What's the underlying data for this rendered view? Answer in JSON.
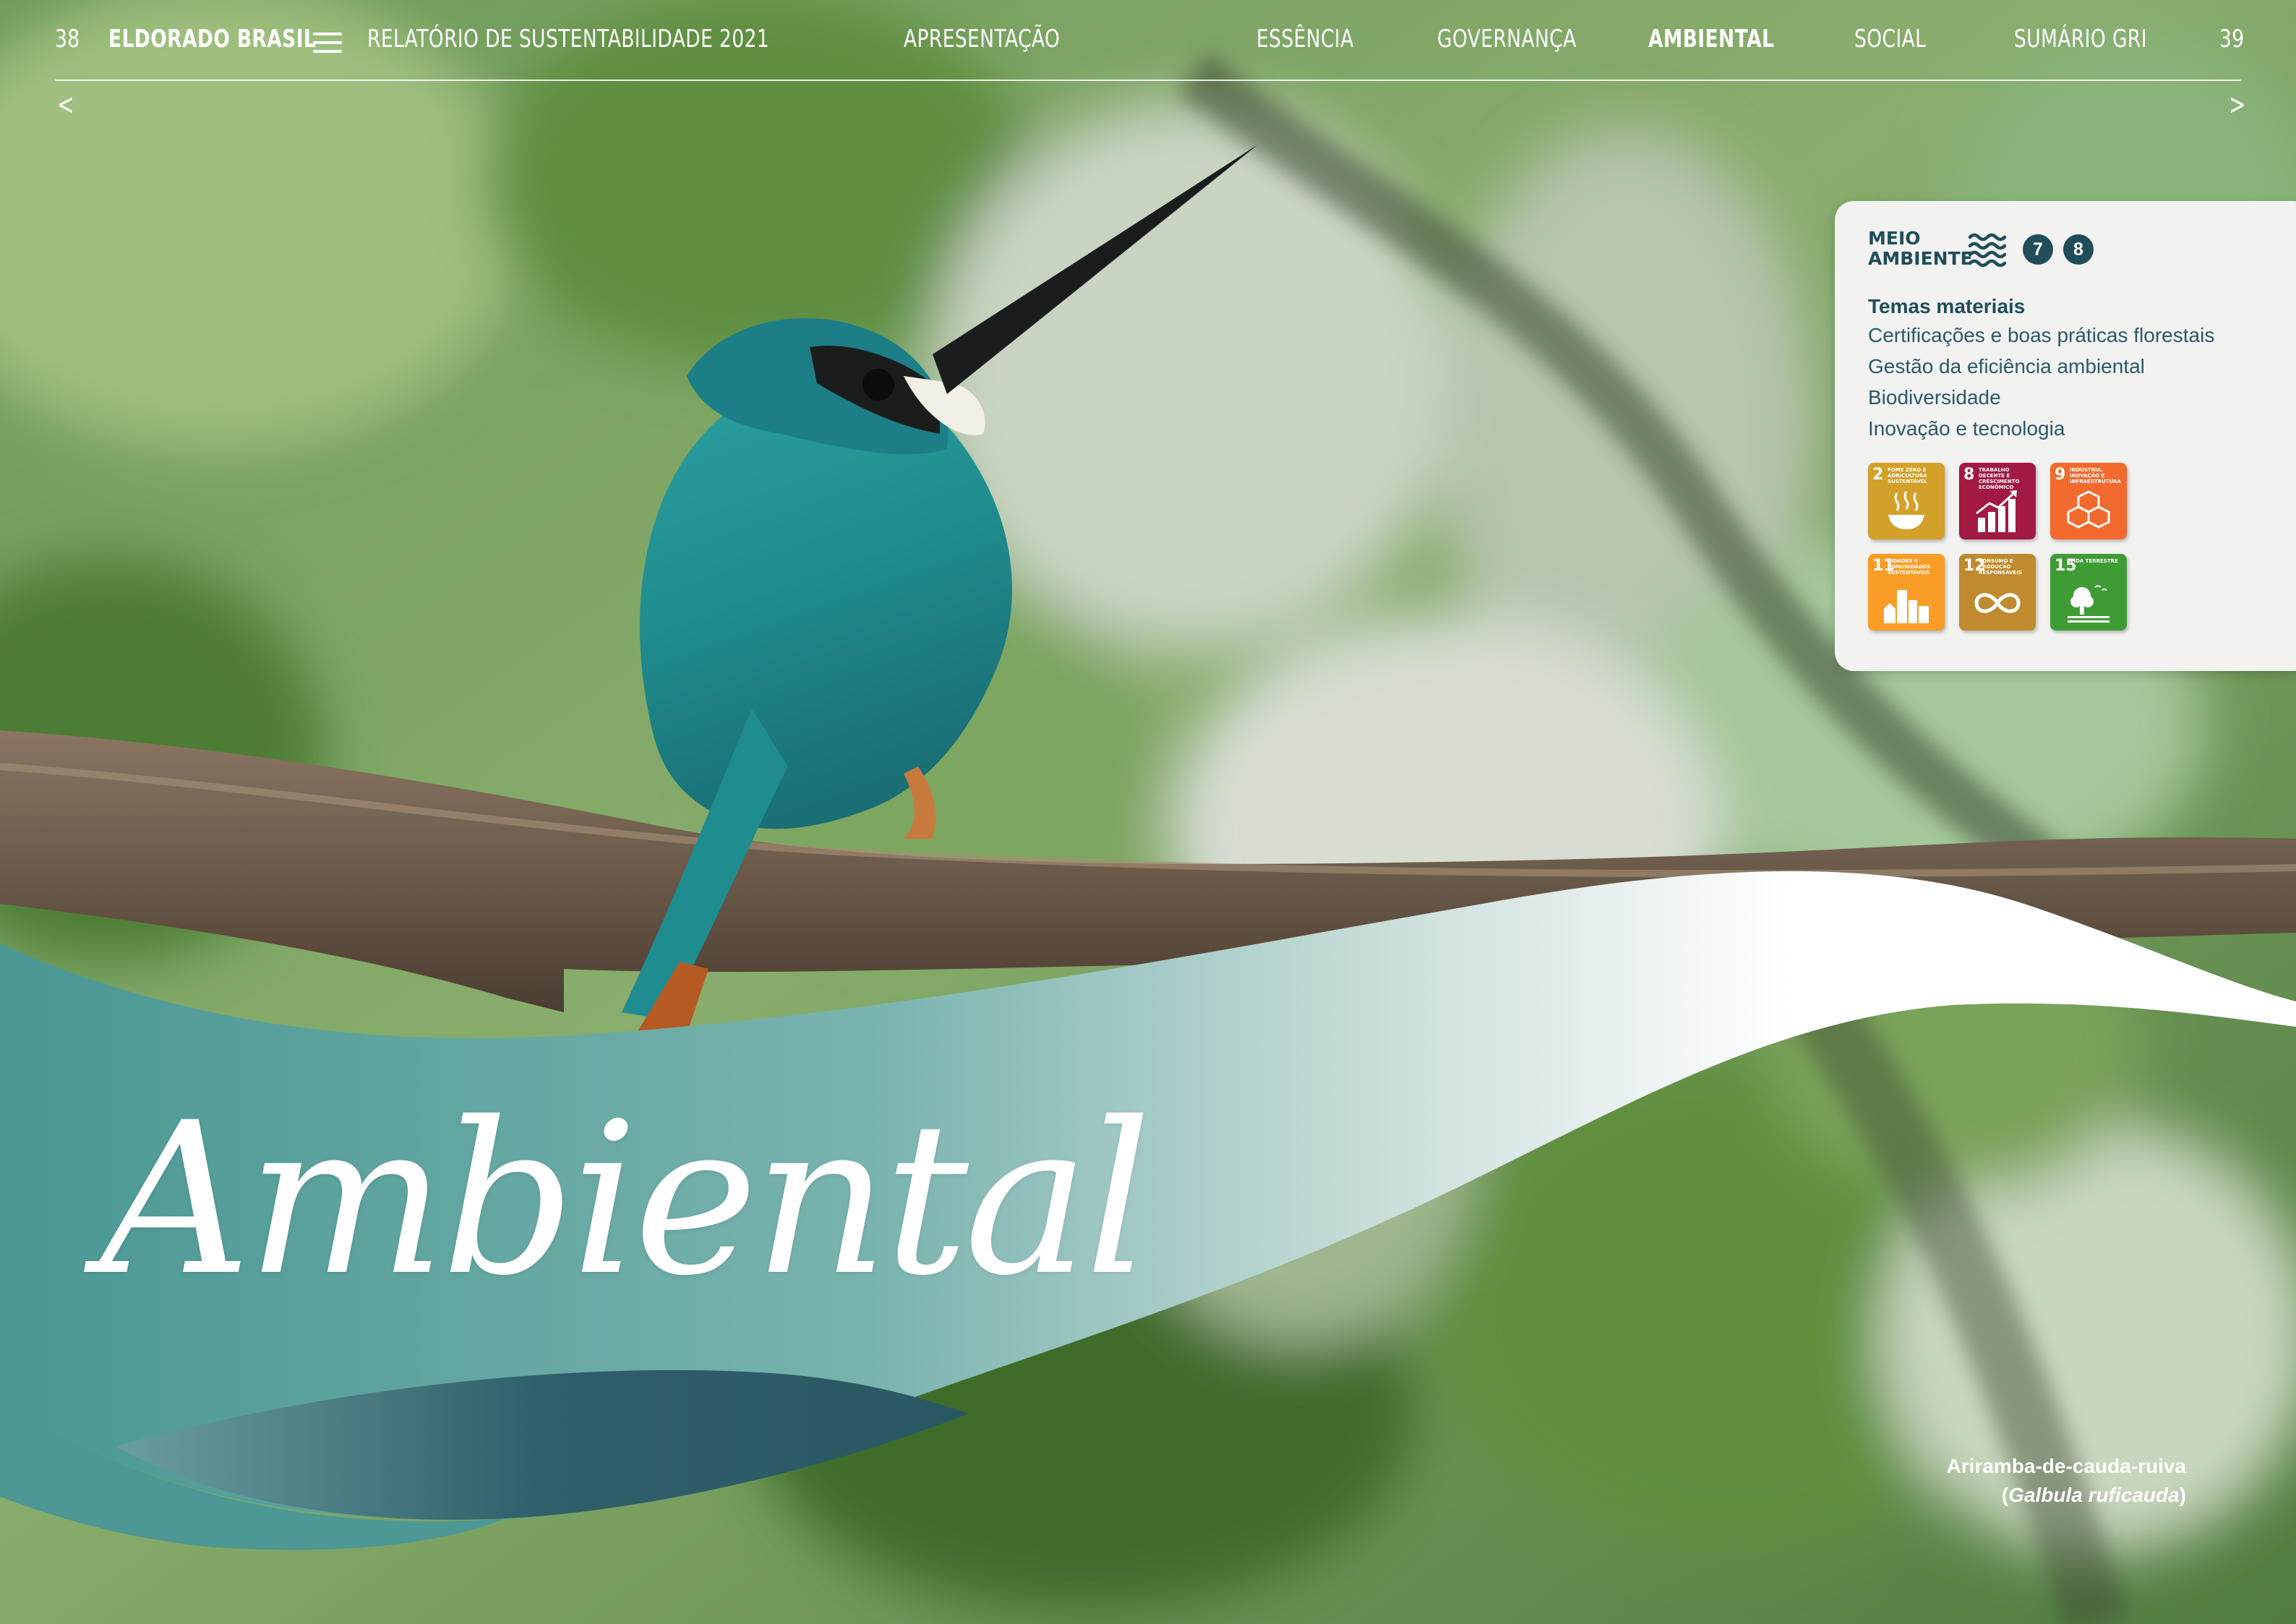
{
  "nav": {
    "page_left": "38",
    "brand": "ELDORADO BRASIL",
    "report": "RELATÓRIO DE SUSTENTABILIDADE 2021",
    "items": [
      {
        "label": "APRESENTAÇÃO",
        "active": false
      },
      {
        "label": "ESSÊNCIA",
        "active": false
      },
      {
        "label": "GOVERNANÇA",
        "active": false
      },
      {
        "label": "AMBIENTAL",
        "active": true
      },
      {
        "label": "SOCIAL",
        "active": false
      },
      {
        "label": "SUMÁRIO GRI",
        "active": false
      }
    ],
    "page_right": "39",
    "prev": "<",
    "next": ">"
  },
  "card": {
    "title_line1": "MEIO",
    "title_line2": "AMBIENTE",
    "badges": [
      "7",
      "8"
    ],
    "topics_title": "Temas materiais",
    "topics": [
      "Certificações e boas práticas florestais",
      "Gestão da eficiência ambiental",
      "Biodiversidade",
      "Inovação e tecnologia"
    ],
    "sdgs": [
      {
        "num": "2",
        "label": "FOME ZERO E AGRICULTURA SUSTENTÁVEL",
        "color": "#d3a029",
        "icon": "bowl-icon"
      },
      {
        "num": "8",
        "label": "TRABALHO DECENTE E CRESCIMENTO ECONÔMICO",
        "color": "#a21942",
        "icon": "growth-chart-icon"
      },
      {
        "num": "9",
        "label": "INDÚSTRIA, INOVAÇÃO E INFRAESTRUTURA",
        "color": "#f26a2d",
        "icon": "cubes-icon"
      },
      {
        "num": "11",
        "label": "CIDADES E COMUNIDADES SUSTENTÁVEIS",
        "color": "#f99d26",
        "icon": "city-icon"
      },
      {
        "num": "12",
        "label": "CONSUMO E PRODUÇÃO RESPONSÁVEIS",
        "color": "#bf8b2e",
        "icon": "infinity-icon"
      },
      {
        "num": "15",
        "label": "VIDA TERRESTRE",
        "color": "#3f9c35",
        "icon": "tree-icon"
      }
    ]
  },
  "title": "Ambiental",
  "caption": {
    "line1": "Ariramba-de-cauda-ruiva",
    "open": "(",
    "species": "Galbula ruficauda",
    "close": ")"
  },
  "colors": {
    "teal_dark": "#2e5d66",
    "teal": "#4e9b98",
    "card_text": "#1f4d5a"
  }
}
